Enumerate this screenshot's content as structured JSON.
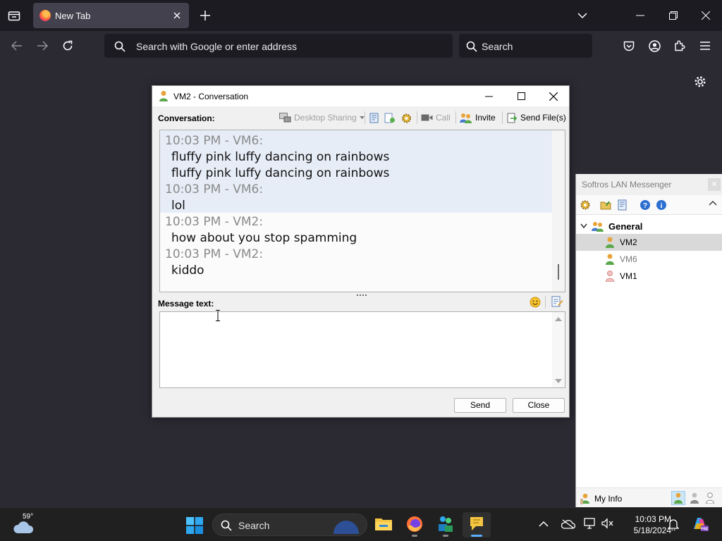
{
  "browser": {
    "tab_title": "New Tab",
    "url_placeholder": "Search with Google or enter address",
    "search_placeholder": "Search"
  },
  "conversation": {
    "window_title": "VM2 - Conversation",
    "label": "Conversation:",
    "toolbar": {
      "desktop_sharing": "Desktop Sharing",
      "call": "Call",
      "invite": "Invite",
      "send_files": "Send File(s)"
    },
    "messages": [
      {
        "header": "10:03 PM - VM6:",
        "lines": [
          "fluffy pink luffy dancing on rainbows",
          "fluffy pink luffy dancing on rainbows"
        ]
      },
      {
        "header": "10:03 PM - VM6:",
        "lines": [
          "lol"
        ]
      },
      {
        "header": "10:03 PM - VM2:",
        "lines": [
          "how about you stop spamming"
        ]
      },
      {
        "header": "10:03 PM - VM2:",
        "lines": [
          "kiddo"
        ]
      }
    ],
    "message_label": "Message text:",
    "message_value": "",
    "send_label": "Send",
    "close_label": "Close"
  },
  "lan": {
    "title": "Softros LAN Messenger",
    "group": "General",
    "users": [
      {
        "name": "VM2",
        "status": "online",
        "selected": true
      },
      {
        "name": "VM6",
        "status": "online",
        "selected": false
      },
      {
        "name": "VM1",
        "status": "offline",
        "selected": false
      }
    ],
    "my_info": "My Info"
  },
  "taskbar": {
    "temperature": "59°",
    "search_label": "Search",
    "time": "10:03 PM",
    "date": "5/18/2024"
  },
  "colors": {
    "browser_bg": "#1c1b22",
    "toolbar_bg": "#2b2a33",
    "chat_highlight": "#e7edf7",
    "online_user": "#e8a33a",
    "offline_user": "#e08b8b"
  }
}
